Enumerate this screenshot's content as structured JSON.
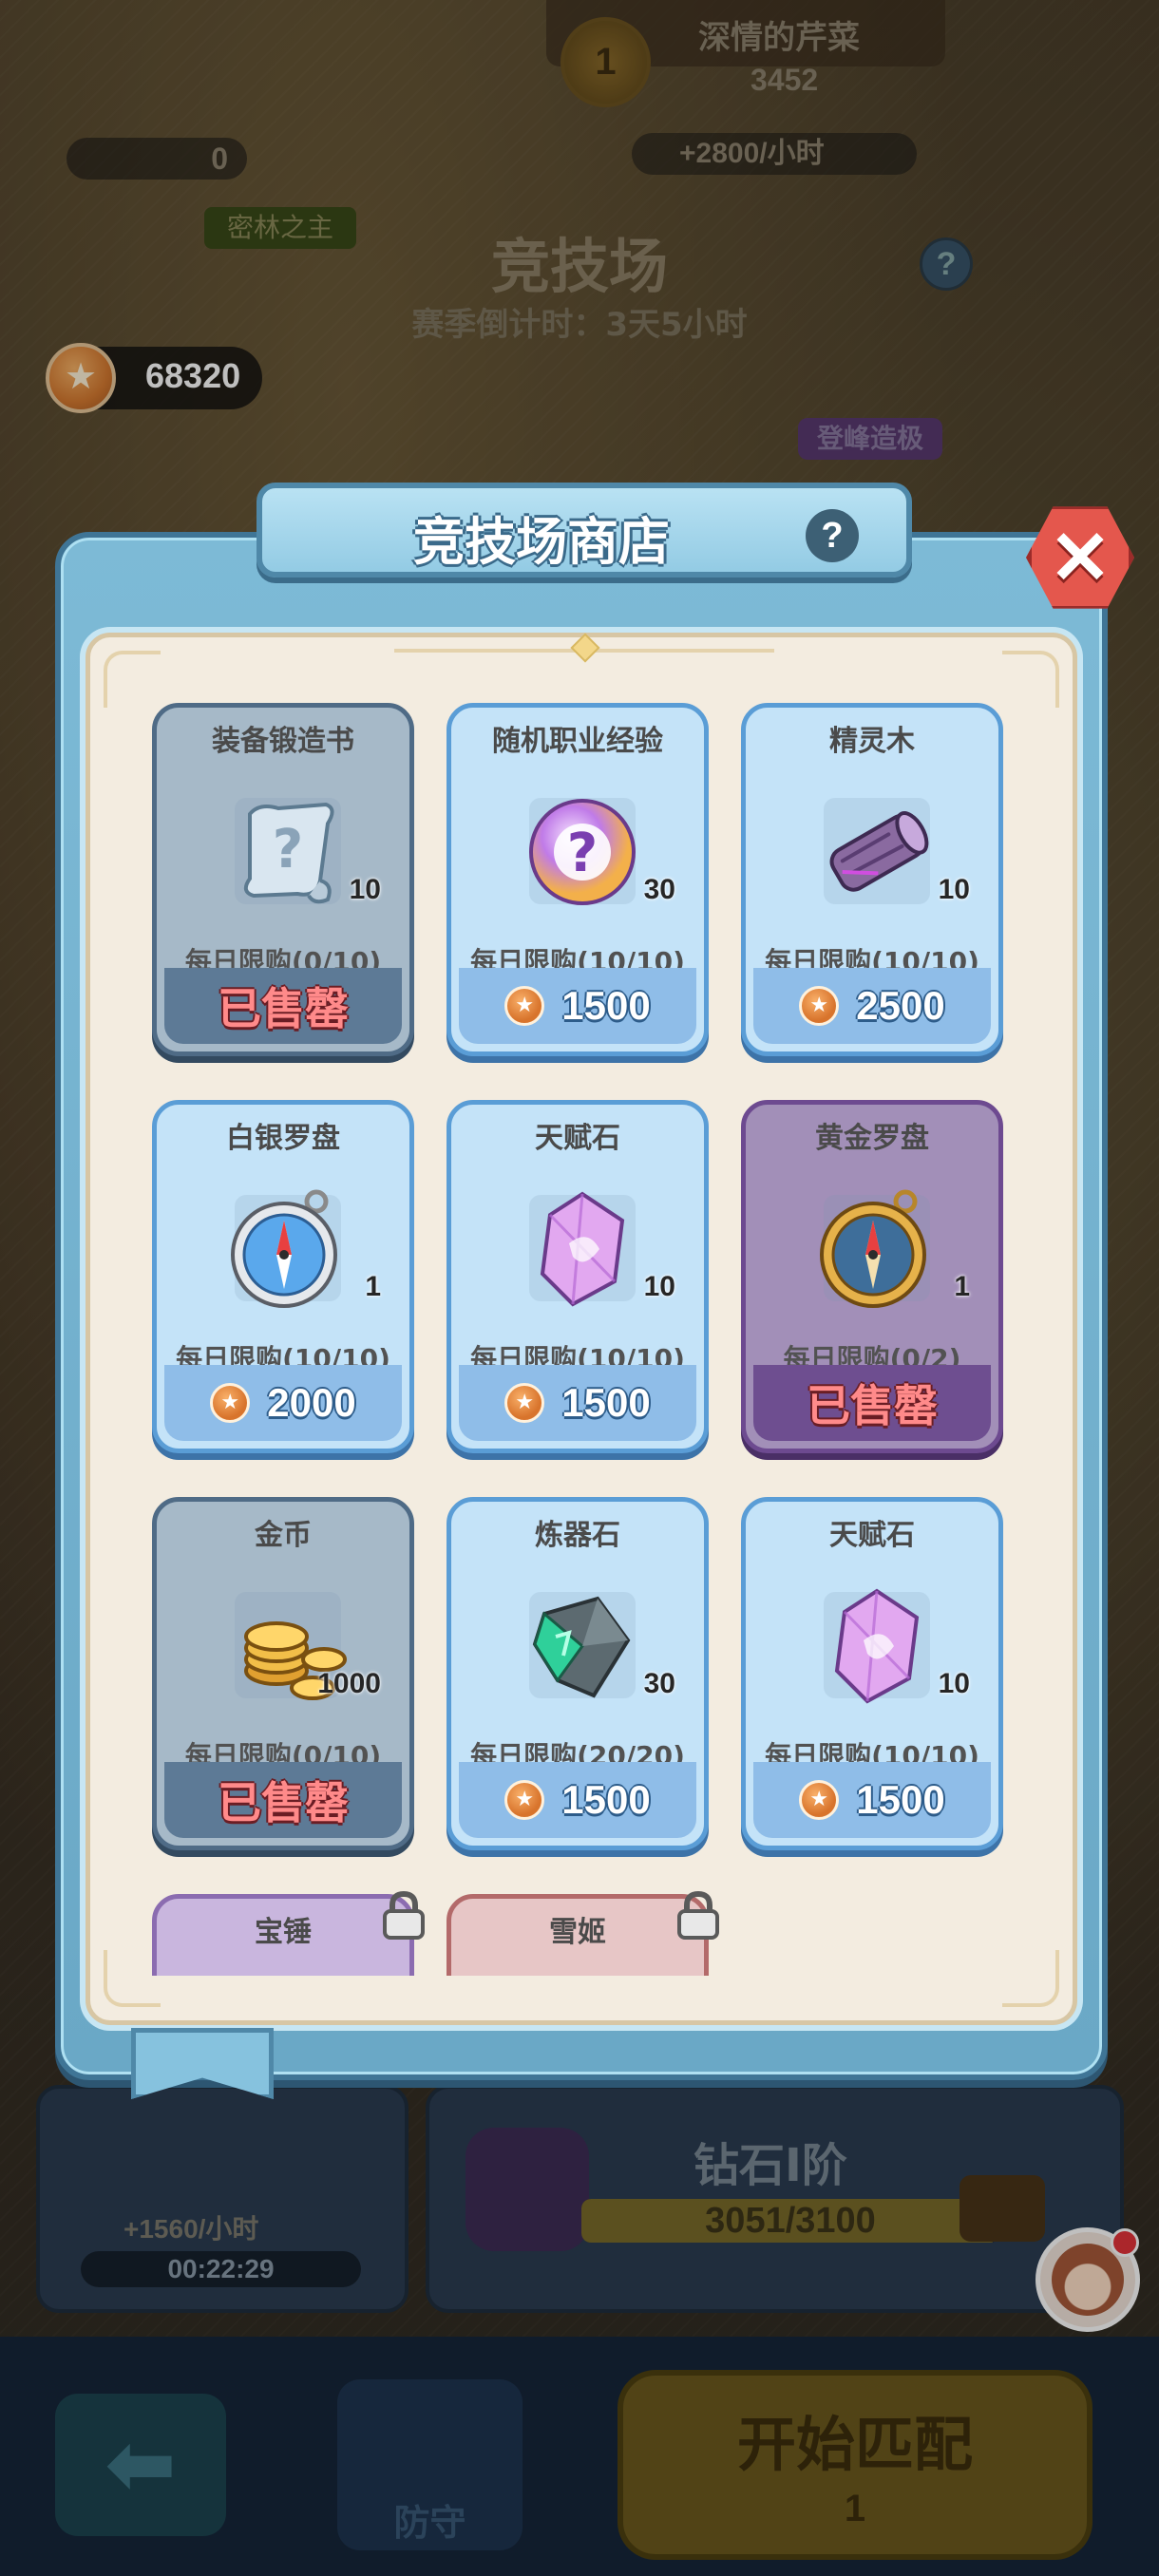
{
  "background": {
    "rank_badge": "1",
    "player_name": "深情的芹菜",
    "player_score": "3452",
    "income_top": "+2800/小时",
    "ticket_count": "0",
    "user_tag": "密林之主",
    "arena_title": "竞技场",
    "season_countdown": "赛季倒计时：3天5小时",
    "help_symbol": "?",
    "coin_balance": "68320",
    "peak_tag": "登峰造极",
    "defense_income": "+1560/小时",
    "defense_timer": "00:22:29",
    "tier_name": "钻石I阶",
    "tier_progress": "3051/3100",
    "tier_progress_fraction": 0.984,
    "back_icon": "arrow-left-icon",
    "defend_label": "防守",
    "match_label": "开始匹配",
    "match_cost": "1"
  },
  "shop": {
    "title": "竞技场商店",
    "help_symbol": "?",
    "close_symbol": "✕",
    "currency_icon": "arena-coin-icon",
    "items": [
      {
        "name": "装备锻造书",
        "icon": "scroll-question-icon",
        "qty": "10",
        "limit": "每日限购(0/10)",
        "price": "",
        "sold_out": "已售罄",
        "style": "sold-grey"
      },
      {
        "name": "随机职业经验",
        "icon": "mystery-orb-icon",
        "qty": "30",
        "limit": "每日限购(10/10)",
        "price": "1500",
        "sold_out": "",
        "style": "normal"
      },
      {
        "name": "精灵木",
        "icon": "wood-log-icon",
        "qty": "10",
        "limit": "每日限购(10/10)",
        "price": "2500",
        "sold_out": "",
        "style": "normal"
      },
      {
        "name": "白银罗盘",
        "icon": "silver-compass-icon",
        "qty": "1",
        "limit": "每日限购(10/10)",
        "price": "2000",
        "sold_out": "",
        "style": "normal"
      },
      {
        "name": "天赋石",
        "icon": "talent-crystal-icon",
        "qty": "10",
        "limit": "每日限购(10/10)",
        "price": "1500",
        "sold_out": "",
        "style": "normal"
      },
      {
        "name": "黄金罗盘",
        "icon": "gold-compass-icon",
        "qty": "1",
        "limit": "每日限购(0/2)",
        "price": "",
        "sold_out": "已售罄",
        "style": "sold-purple"
      },
      {
        "name": "金币",
        "icon": "gold-coins-icon",
        "qty": "1000",
        "limit": "每日限购(0/10)",
        "price": "",
        "sold_out": "已售罄",
        "style": "sold-grey"
      },
      {
        "name": "炼器石",
        "icon": "refining-stone-icon",
        "qty": "30",
        "limit": "每日限购(20/20)",
        "price": "1500",
        "sold_out": "",
        "style": "normal"
      },
      {
        "name": "天赋石",
        "icon": "talent-crystal-icon",
        "qty": "10",
        "limit": "每日限购(10/10)",
        "price": "1500",
        "sold_out": "",
        "style": "normal"
      },
      {
        "name": "宝锤",
        "icon": "lock-icon",
        "qty": "",
        "limit": "",
        "price": "",
        "sold_out": "",
        "style": "locked-purple"
      },
      {
        "name": "雪姬",
        "icon": "lock-icon",
        "qty": "",
        "limit": "",
        "price": "",
        "sold_out": "",
        "style": "locked-red"
      }
    ]
  },
  "colors": {
    "modal_blue": "#7dbad6",
    "card_blue": "#c4e3f8",
    "sold_red": "#ff8a8a",
    "coin_orange": "#d8742c"
  }
}
